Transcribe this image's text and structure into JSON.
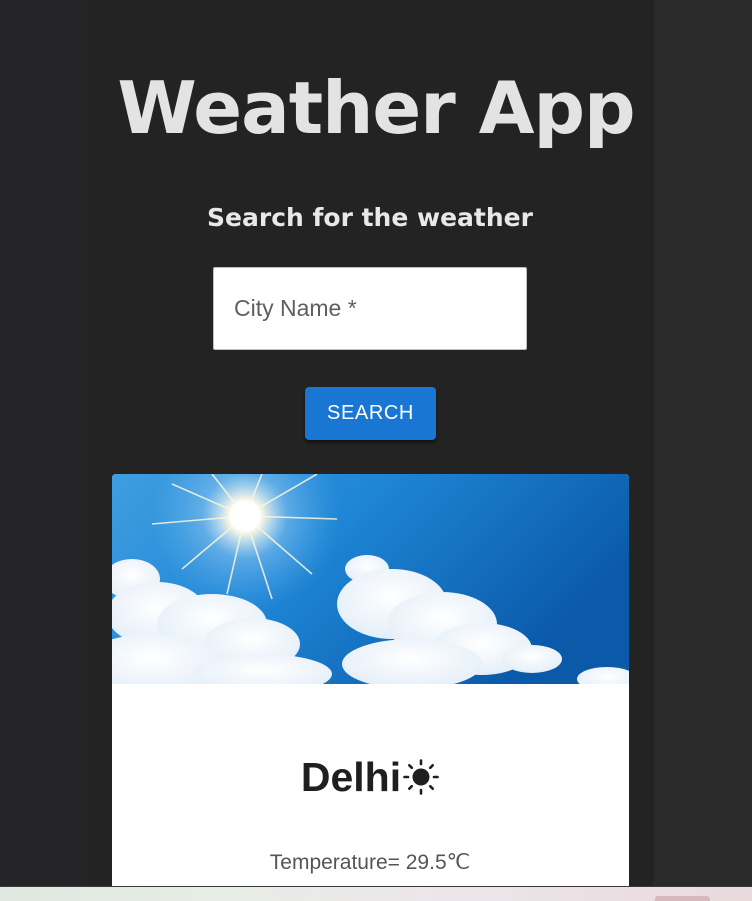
{
  "header": {
    "title": "Weather App",
    "subtitle": "Search for the weather"
  },
  "search": {
    "placeholder": "City Name *",
    "value": "",
    "button_label": "SEARCH"
  },
  "result": {
    "city": "Delhi",
    "weather_icon": "sun-icon",
    "temperature_text": "Temperature= 29.5℃"
  },
  "colors": {
    "background": "#242424",
    "button": "#1976d2",
    "card": "#ffffff"
  }
}
